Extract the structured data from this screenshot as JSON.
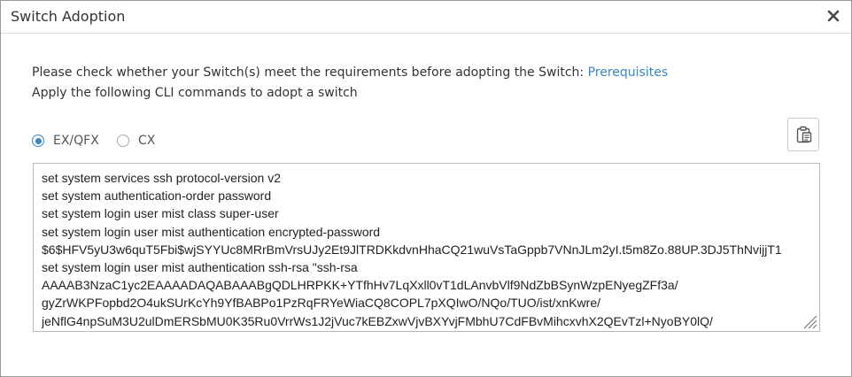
{
  "dialog": {
    "title": "Switch Adoption",
    "close_icon": "close-icon"
  },
  "instructions": {
    "requirements_text": "Please check whether your Switch(s) meet the requirements before adopting the Switch: ",
    "prerequisites_link": "Prerequisites",
    "apply_text": "Apply the following CLI commands to adopt a switch",
    "link_color": "#3a86c8"
  },
  "switch_type": {
    "selected": "EX/QFX",
    "options": [
      {
        "label": "EX/QFX",
        "selected": true
      },
      {
        "label": "CX",
        "selected": false
      }
    ]
  },
  "copy_button": {
    "icon": "clipboard-icon"
  },
  "cli_commands": [
    "set system services ssh protocol-version v2",
    "set system authentication-order password",
    "set system login user mist class super-user",
    "set system login user mist authentication encrypted-password",
    "$6$HFV5yU3w6quT5Fbi$wjSYYUc8MRrBmVrsUJy2Et9JlTRDKkdvnHhaCQ21wuVsTaGppb7VNnJLm2yI.t5m8Zo.88UP.3DJ5ThNvijjT1",
    "set system login user mist authentication ssh-rsa \"ssh-rsa",
    "AAAAB3NzaC1yc2EAAAADAQABAAABgQDLHRPKK+YTfhHv7LqXxll0vT1dLAnvbVlf9NdZbBSynWzpENyegZFf3a/",
    "gyZrWKPFopbd2O4ukSUrKcYh9YfBABPo1PzRqFRYeWiaCQ8COPL7pXQIwO/NQo/TUO/ist/xnKwre/",
    "jeNflG4npSuM3U2ulDmERSbMU0K35Ru0VrrWs1J2jVuc7kEBZxwVjvBXYvjFMbhU7CdFBvMihcxvhX2QEvTzl+NyoBY0lQ/"
  ]
}
